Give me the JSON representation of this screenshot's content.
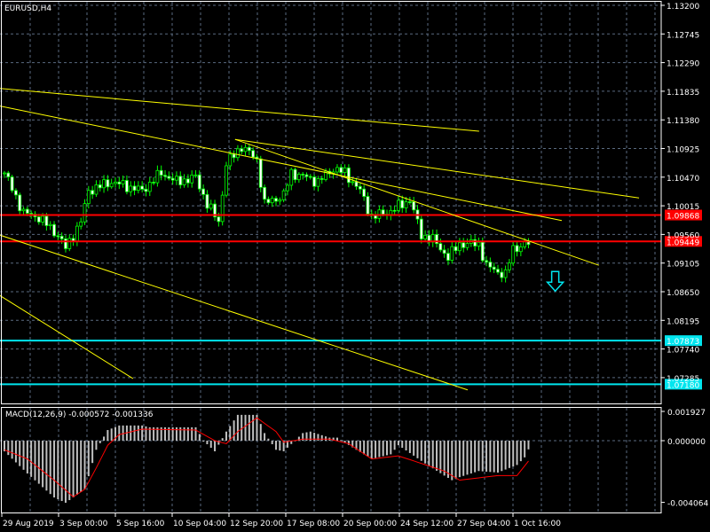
{
  "chart_data": {
    "type": "candlestick",
    "title": "EURUSD,H4",
    "symbol": "EURUSD",
    "timeframe": "H4",
    "bar_count": 138,
    "ylim": [
      1.0704,
      1.1325
    ],
    "price_ticks": [
      "1.13200",
      "1.12745",
      "1.12290",
      "1.11835",
      "1.11380",
      "1.10925",
      "1.10470",
      "1.10015",
      "1.09560",
      "1.09105",
      "1.08650",
      "1.08195",
      "1.07740",
      "1.07285"
    ],
    "time_labels": [
      "29 Aug 2019",
      "3 Sep 00:00",
      "5 Sep 16:00",
      "10 Sep 04:00",
      "12 Sep 20:00",
      "17 Sep 08:00",
      "20 Sep 00:00",
      "24 Sep 12:00",
      "27 Sep 04:00",
      "1 Oct 16:00"
    ],
    "close_keypoints": [
      [
        0,
        1.10537
      ],
      [
        5,
        1.09903
      ],
      [
        9,
        1.09832
      ],
      [
        14,
        1.09551
      ],
      [
        16,
        1.09339
      ],
      [
        20,
        1.09762
      ],
      [
        22,
        1.10255
      ],
      [
        28,
        1.10396
      ],
      [
        32,
        1.10326
      ],
      [
        36,
        1.10255
      ],
      [
        41,
        1.10537
      ],
      [
        45,
        1.10396
      ],
      [
        50,
        1.10467
      ],
      [
        53,
        1.10044
      ],
      [
        56,
        1.09762
      ],
      [
        58,
        1.10678
      ],
      [
        62,
        1.1096
      ],
      [
        66,
        1.10748
      ],
      [
        68,
        1.10044
      ],
      [
        73,
        1.10185
      ],
      [
        75,
        1.10537
      ],
      [
        79,
        1.10467
      ],
      [
        82,
        1.10396
      ],
      [
        86,
        1.10607
      ],
      [
        89,
        1.10537
      ],
      [
        93,
        1.10255
      ],
      [
        96,
        1.09832
      ],
      [
        101,
        1.09931
      ],
      [
        106,
        1.10114
      ],
      [
        109,
        1.09551
      ],
      [
        112,
        1.0948
      ],
      [
        116,
        1.09198
      ],
      [
        119,
        1.0941
      ],
      [
        124,
        1.0941
      ],
      [
        126,
        1.09057
      ],
      [
        131,
        1.08916
      ],
      [
        133,
        1.09339
      ],
      [
        137,
        1.0941
      ]
    ],
    "horizontal_levels": [
      {
        "price": 1.09868,
        "label": "1.09868",
        "color": "#ff0000"
      },
      {
        "price": 1.09449,
        "label": "1.09449",
        "color": "#ff0000"
      },
      {
        "price": 1.07873,
        "label": "1.07873",
        "color": "#00e5ee"
      },
      {
        "price": 1.0718,
        "label": "1.07180",
        "color": "#00e5ee"
      }
    ],
    "trendlines": [
      {
        "from": [
          -1.2,
          1.1188
        ],
        "to": [
          124.1,
          1.112
        ]
      },
      {
        "from": [
          -1.2,
          1.116
        ],
        "to": [
          145.7,
          1.0978
        ]
      },
      {
        "from": [
          60.3,
          1.1107
        ],
        "to": [
          165.9,
          1.1014
        ]
      },
      {
        "from": [
          60.3,
          1.1107
        ],
        "to": [
          155.4,
          1.0907
        ]
      },
      {
        "from": [
          -1.2,
          1.0955
        ],
        "to": [
          121.1,
          1.0709
        ]
      },
      {
        "from": [
          -1.2,
          1.0859
        ],
        "to": [
          33.6,
          1.0727
        ]
      }
    ],
    "signal_arrow": {
      "direction": "down",
      "bar": 144,
      "price": 1.0897,
      "color": "#00e5ee"
    },
    "macd": {
      "label": "MACD(12,26,9) -0.000572 -0.001336",
      "params": [
        12,
        26,
        9
      ],
      "macd_value": -0.000572,
      "signal_value": -0.001336,
      "ylim": [
        -0.004064,
        0.001927
      ],
      "ticks": [
        "0.001927",
        "0.000000",
        "-0.004064"
      ],
      "histogram_keypoints": [
        [
          0,
          -0.0007
        ],
        [
          6,
          -0.00216
        ],
        [
          13,
          -0.00374
        ],
        [
          16,
          -0.00409
        ],
        [
          21,
          -0.00321
        ],
        [
          24,
          -0.0006
        ],
        [
          27,
          0.0007
        ],
        [
          30,
          0.001
        ],
        [
          36,
          0.001
        ],
        [
          38,
          0.00088
        ],
        [
          50,
          0.00088
        ],
        [
          52,
          0
        ],
        [
          55,
          -0.0007
        ],
        [
          58,
          0.0006
        ],
        [
          61,
          0.0017
        ],
        [
          66,
          0.0017
        ],
        [
          68,
          0.0005
        ],
        [
          71,
          -0.0006
        ],
        [
          73,
          -0.0007
        ],
        [
          78,
          0.0005
        ],
        [
          80,
          0.0006
        ],
        [
          85,
          0.0002
        ],
        [
          87,
          0.0002
        ],
        [
          92,
          -0.0006
        ],
        [
          96,
          -0.0012
        ],
        [
          101,
          -0.0009
        ],
        [
          103,
          -0.0003
        ],
        [
          110,
          -0.0015
        ],
        [
          115,
          -0.0023
        ],
        [
          117,
          -0.0026
        ],
        [
          119,
          -0.0024
        ],
        [
          124,
          -0.002
        ],
        [
          129,
          -0.0021
        ],
        [
          134,
          -0.0016
        ],
        [
          136,
          -0.0011
        ],
        [
          137,
          -0.000572
        ]
      ],
      "signal_keypoints": [
        [
          0,
          -0.0006
        ],
        [
          6,
          -0.0012
        ],
        [
          13,
          -0.0026
        ],
        [
          18,
          -0.0037
        ],
        [
          21,
          -0.0032
        ],
        [
          24,
          -0.0018
        ],
        [
          27,
          -0.0003
        ],
        [
          30,
          0.0004
        ],
        [
          36,
          0.00076
        ],
        [
          50,
          0.0007
        ],
        [
          55,
          0
        ],
        [
          58,
          -0.0002
        ],
        [
          61,
          0.0006
        ],
        [
          66,
          0.0015
        ],
        [
          71,
          0.0006
        ],
        [
          73,
          -0.0001
        ],
        [
          78,
          0.0001
        ],
        [
          85,
          0.0001
        ],
        [
          90,
          -0.0002
        ],
        [
          96,
          -0.0012
        ],
        [
          103,
          -0.001
        ],
        [
          115,
          -0.002
        ],
        [
          119,
          -0.0026
        ],
        [
          129,
          -0.0023
        ],
        [
          134,
          -0.0023
        ],
        [
          137,
          -0.001336
        ]
      ]
    },
    "colors": {
      "background": "#000000",
      "grid": "#5a6a80",
      "bull": "#00ff00",
      "trendline": "#ffff00",
      "histogram": "#c0c0c0",
      "signal": "#ff0000",
      "axis": "#ffffff"
    }
  }
}
